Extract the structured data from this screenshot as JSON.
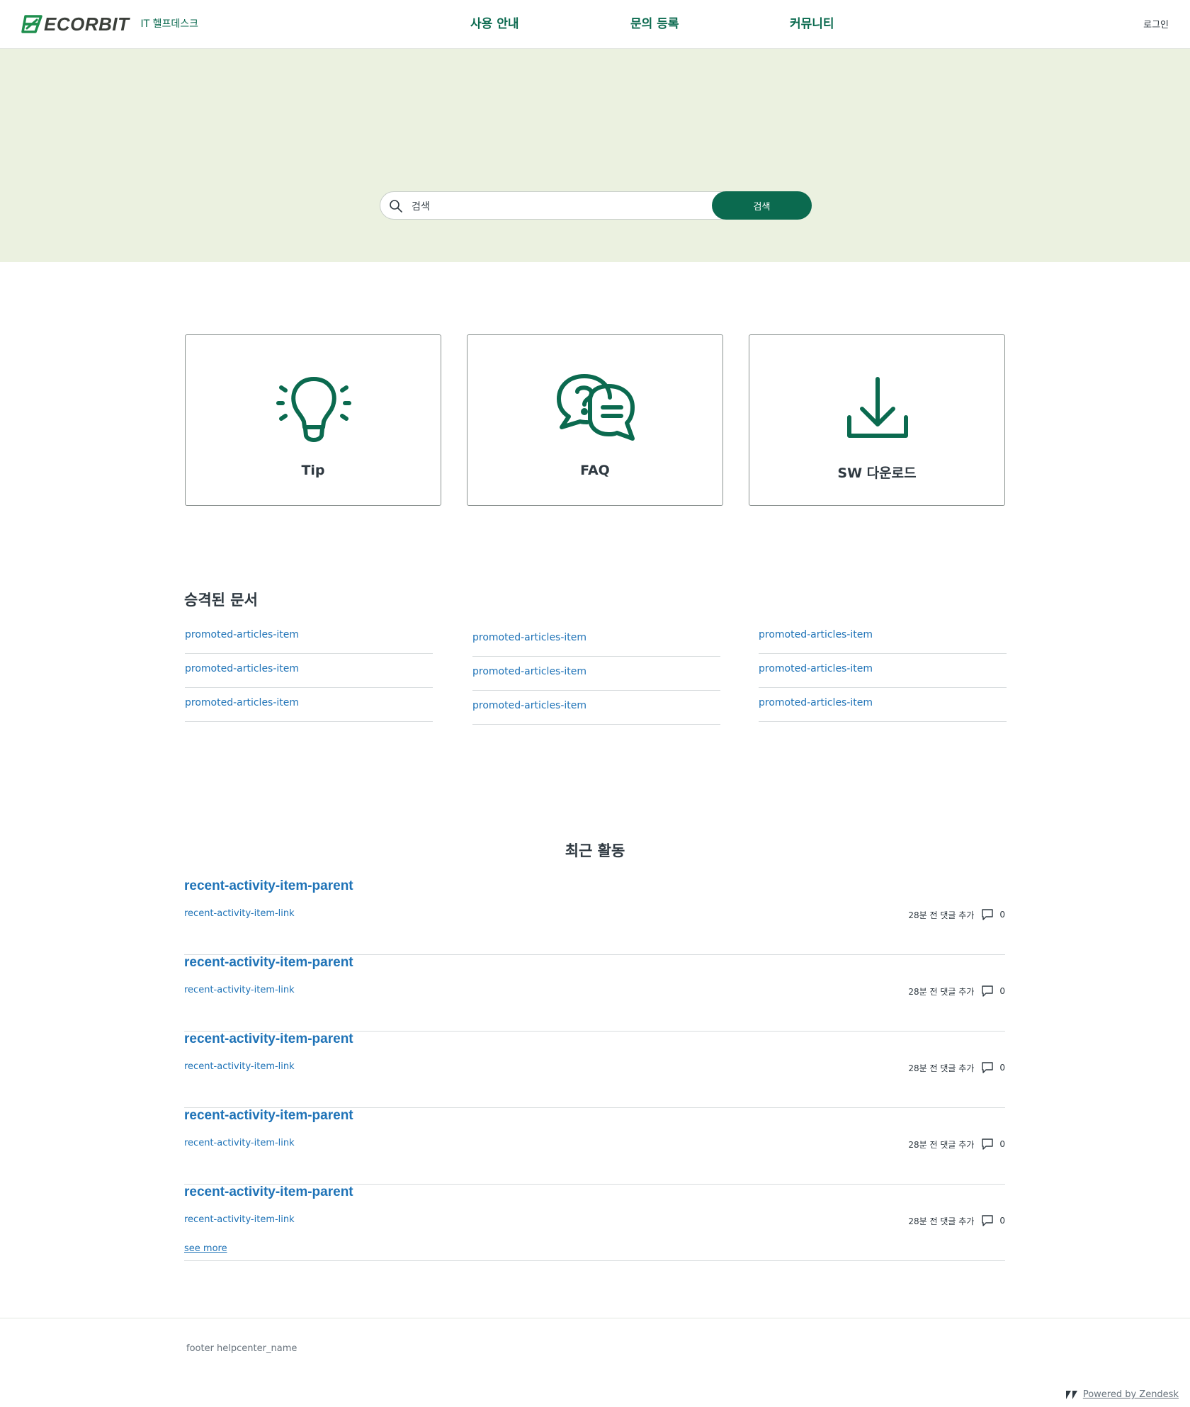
{
  "header": {
    "brand": "ECORBIT",
    "subtitle": "IT 헬프데스크",
    "nav": [
      "사용 안내",
      "문의 등록",
      "커뮤니티"
    ],
    "login": "로그인"
  },
  "hero": {
    "search_value": "검색",
    "search_button": "검색"
  },
  "cards": [
    {
      "label": "Tip",
      "icon": "lightbulb-icon"
    },
    {
      "label": "FAQ",
      "icon": "chat-question-icon"
    },
    {
      "label": "SW 다운로드",
      "icon": "download-icon"
    }
  ],
  "promoted": {
    "title": "승격된 문서",
    "columns": [
      [
        "promoted-articles-item",
        "promoted-articles-item",
        "promoted-articles-item"
      ],
      [
        "promoted-articles-item",
        "promoted-articles-item",
        "promoted-articles-item"
      ],
      [
        "promoted-articles-item",
        "promoted-articles-item",
        "promoted-articles-item"
      ]
    ]
  },
  "recent": {
    "title": "최근 활동",
    "items": [
      {
        "parent": "recent-activity-item-parent",
        "link": "recent-activity-item-link",
        "meta": "28분 전 댓글 추가",
        "count": "0"
      },
      {
        "parent": "recent-activity-item-parent",
        "link": "recent-activity-item-link",
        "meta": "28분 전 댓글 추가",
        "count": "0"
      },
      {
        "parent": "recent-activity-item-parent",
        "link": "recent-activity-item-link",
        "meta": "28분 전 댓글 추가",
        "count": "0"
      },
      {
        "parent": "recent-activity-item-parent",
        "link": "recent-activity-item-link",
        "meta": "28분 전 댓글 추가",
        "count": "0"
      },
      {
        "parent": "recent-activity-item-parent",
        "link": "recent-activity-item-link",
        "meta": "28분 전 댓글 추가",
        "count": "0"
      }
    ],
    "see_more": "see more"
  },
  "footer": {
    "name": "footer helpcenter_name",
    "powered": "Powered by Zendesk"
  },
  "colors": {
    "brand_green": "#0b6a4f",
    "hero_bg": "#ebf1e0",
    "link_blue": "#1f73b7"
  }
}
